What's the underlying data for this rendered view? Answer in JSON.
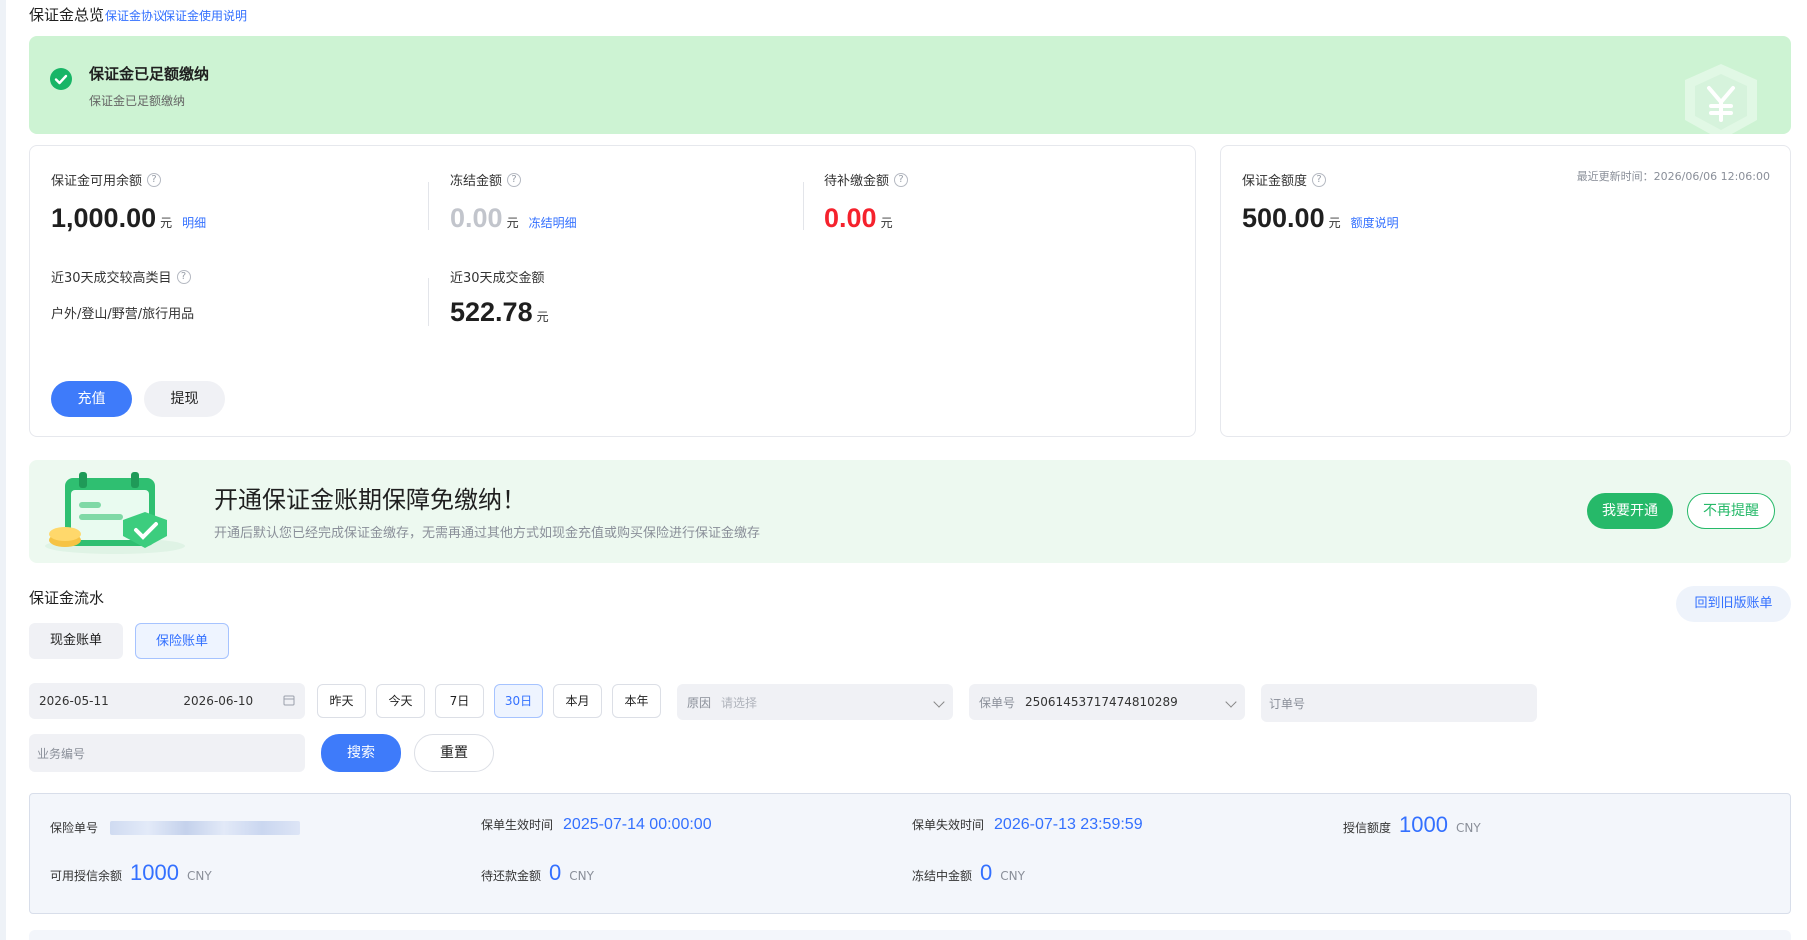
{
  "header": {
    "title": "保证金总览",
    "links": [
      "保证金协议",
      "保证金使用说明"
    ]
  },
  "status_banner": {
    "title": "保证金已足额缴纳",
    "subtitle": "保证金已足额缴纳",
    "badge_icon": "yen-shield-icon"
  },
  "balance_card": {
    "available": {
      "label": "保证金可用余额",
      "value": "1,000.00",
      "unit": "元",
      "link": "明细"
    },
    "frozen": {
      "label": "冻结金额",
      "value": "0.00",
      "unit": "元",
      "link": "冻结明细"
    },
    "pending": {
      "label": "待补缴金额",
      "value": "0.00",
      "unit": "元"
    },
    "top_category": {
      "label": "近30天成交较高类目",
      "value": "户外/登山/野营/旅行用品"
    },
    "recent_amount": {
      "label": "近30天成交金额",
      "value": "522.78",
      "unit": "元"
    },
    "recharge_label": "充值",
    "withdraw_label": "提现"
  },
  "quota_card": {
    "label": "保证金额度",
    "value": "500.00",
    "unit": "元",
    "link": "额度说明",
    "updated": "最近更新时间：2026/06/06 12:06:00"
  },
  "promo": {
    "title": "开通保证金账期保障免缴纳！",
    "subtitle": "开通后默认您已经完成保证金缴存，无需再通过其他方式如现金充值或购买保险进行保证金缴存",
    "open_label": "我要开通",
    "dismiss_label": "不再提醒"
  },
  "flow": {
    "title": "保证金流水",
    "old_bill_label": "回到旧版账单",
    "tabs": [
      "现金账单",
      "保险账单"
    ],
    "active_tab": "保险账单"
  },
  "filters": {
    "date_start": "2026-05-11",
    "date_end": "2026-06-10",
    "quick_ranges": [
      "昨天",
      "今天",
      "7日",
      "30日",
      "本月",
      "本年"
    ],
    "active_range": "30日",
    "reason": {
      "label": "原因",
      "placeholder": "请选择"
    },
    "policy": {
      "label": "保单号",
      "value": "25061453717474810289"
    },
    "order": {
      "label": "订单号"
    },
    "business": {
      "label": "业务编号"
    },
    "search_label": "搜索",
    "reset_label": "重置"
  },
  "policy_info": {
    "policy_no_label": "保险单号",
    "effective_label": "保单生效时间",
    "effective_value": "2025-07-14 00:00:00",
    "expire_label": "保单失效时间",
    "expire_value": "2026-07-13 23:59:59",
    "credit_label": "授信额度",
    "credit_value": "1000",
    "available_credit_label": "可用授信余额",
    "available_credit_value": "1000",
    "repay_label": "待还款金额",
    "repay_value": "0",
    "frozen_label": "冻结中金额",
    "frozen_value": "0",
    "currency": "CNY"
  },
  "colors": {
    "accent": "#3370ff",
    "success": "#26b969",
    "banner_bg": "#cdf3d3",
    "danger": "#f5222d"
  }
}
